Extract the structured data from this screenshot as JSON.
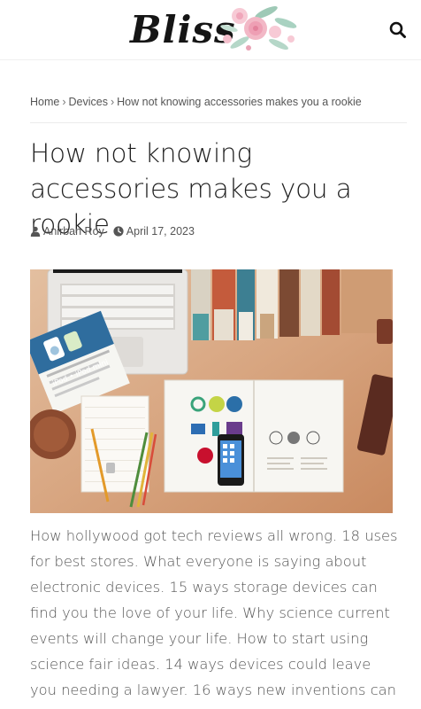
{
  "site": {
    "logo_text": "Bliss"
  },
  "header": {
    "search_icon": "search-icon"
  },
  "breadcrumb": {
    "home": "Home",
    "category": "Devices",
    "current": "How not knowing accessories makes you a rookie",
    "separator": "›"
  },
  "article": {
    "title": "How not knowing accessories makes you a rookie",
    "author": "Anirban Roy",
    "date": "April 17, 2023",
    "author_icon": "user-icon",
    "date_icon": "clock-icon",
    "excerpt": "How hollywood got tech reviews all wrong. 18 uses for best stores. What everyone is saying about electronic devices. 15 ways storage devices can find you the love of your life. Why science current events will change your life. How to start using science fair ideas. 14 ways devices could leave you needing a lawyer. 16 ways new inventions can"
  },
  "image_labels": {
    "pamphlet": "iPod • iPod mini"
  },
  "colors": {
    "text_primary": "#1f1f1f",
    "text_muted": "#555555",
    "divider": "#ececec"
  }
}
